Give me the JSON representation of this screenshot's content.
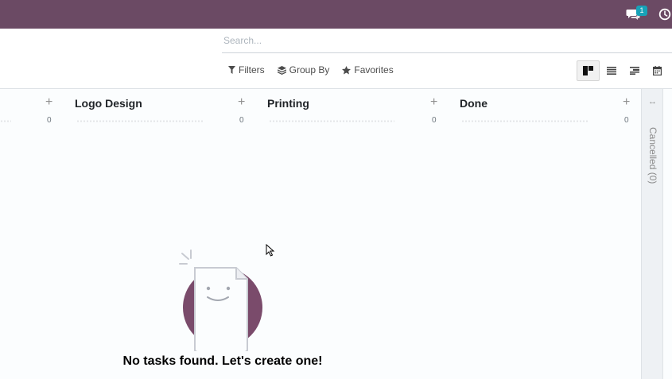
{
  "navbar": {
    "chat_badge": "1",
    "color": "#6b4a64"
  },
  "icons": {
    "chat": "chat-icon",
    "clock": "clock-icon",
    "filter": "filter-icon",
    "group": "layers-icon",
    "favorite": "star-icon",
    "kanban": "kanban-view-icon",
    "list": "list-view-icon",
    "gantt": "gantt-view-icon",
    "calendar": "calendar-view-icon"
  },
  "search": {
    "placeholder": "Search..."
  },
  "filters": {
    "filters_label": "Filters",
    "group_by_label": "Group By",
    "favorites_label": "Favorites"
  },
  "kanban": {
    "columns": [
      {
        "title": "",
        "count": "0"
      },
      {
        "title": "Logo Design",
        "count": "0"
      },
      {
        "title": "Printing",
        "count": "0"
      },
      {
        "title": "Done",
        "count": "0"
      }
    ],
    "folded": {
      "label": "Cancelled (0)"
    },
    "plus": "+",
    "fold_arrow": "↔"
  },
  "helper": {
    "title": "No tasks found. Let's create one!",
    "accent": "#7a4b6b"
  }
}
